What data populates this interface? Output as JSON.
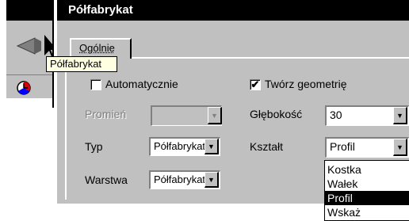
{
  "dialog": {
    "title": "Półfabrykat"
  },
  "tooltip": {
    "text": "Półfabrykat"
  },
  "tabs": [
    {
      "label": "Ogólnie"
    }
  ],
  "auto_checkbox": {
    "label": "Automatycznie",
    "checked": false
  },
  "geometry_checkbox": {
    "label": "Twórz geometrię",
    "checked": true
  },
  "radius": {
    "label": "Promień",
    "value": ""
  },
  "depth": {
    "label": "Głębokość",
    "value": "30"
  },
  "type": {
    "label": "Typ",
    "value": "Półfabrykat"
  },
  "shape": {
    "label": "Kształt",
    "value": "Profil"
  },
  "layer": {
    "label": "Warstwa",
    "value": "Półfabrykat"
  },
  "shape_options": [
    {
      "label": "Kostka",
      "selected": false
    },
    {
      "label": "Wałek",
      "selected": false
    },
    {
      "label": "Profil",
      "selected": true
    },
    {
      "label": "Wskaż",
      "selected": false
    }
  ],
  "icons": {
    "toolbar_top": "stock-shape-icon",
    "toolbar_cursor": "arrow-cursor-icon",
    "toolbar_clock": "clock-icon",
    "dropdown": "down-triangle-icon"
  }
}
